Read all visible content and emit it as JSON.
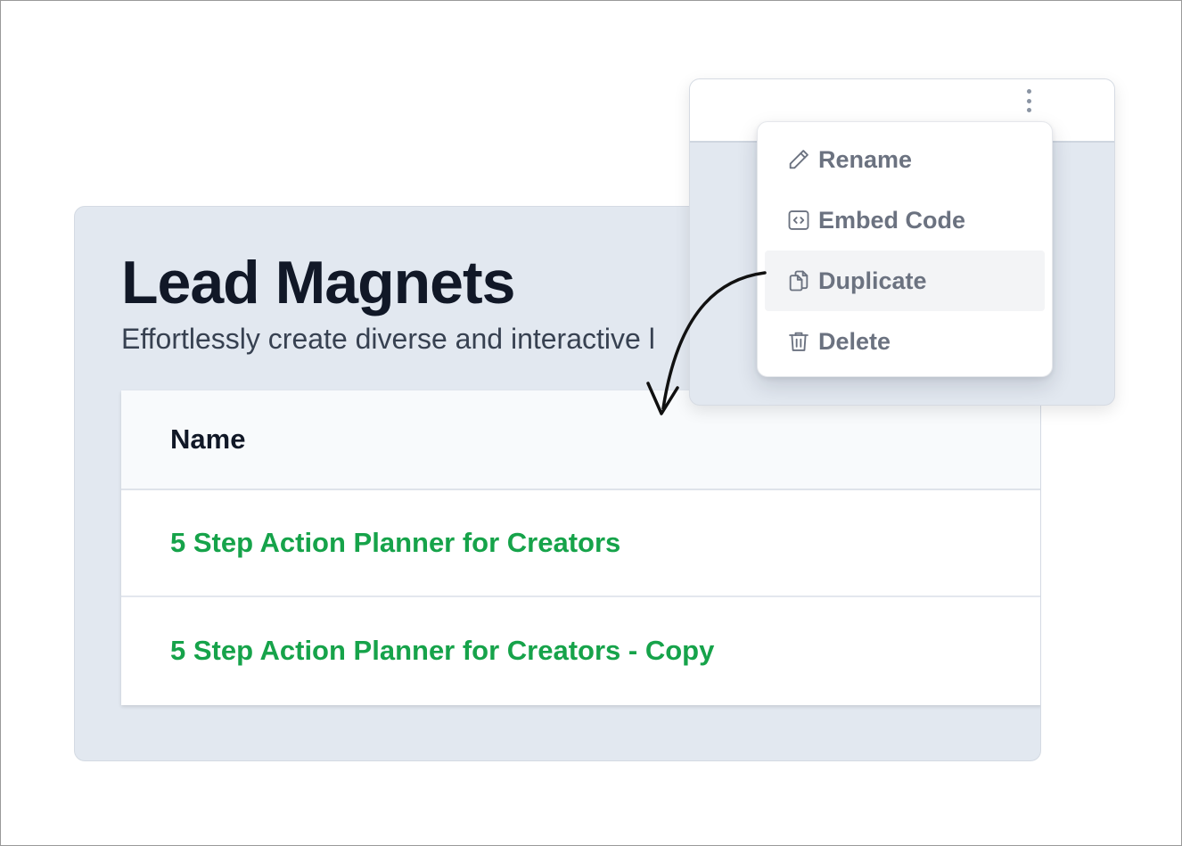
{
  "page": {
    "title": "Lead Magnets",
    "subtitle": "Effortlessly create diverse and interactive l"
  },
  "table": {
    "header_name": "Name",
    "rows": [
      {
        "name": "5 Step Action Planner for Creators"
      },
      {
        "name": "5 Step Action Planner for Creators - Copy"
      }
    ]
  },
  "menu": {
    "items": [
      {
        "label": "Rename",
        "icon": "pencil-icon"
      },
      {
        "label": "Embed Code",
        "icon": "code-icon"
      },
      {
        "label": "Duplicate",
        "icon": "copy-icon",
        "highlighted": true
      },
      {
        "label": "Delete",
        "icon": "trash-icon"
      }
    ]
  },
  "colors": {
    "panel_bg": "#e2e8f0",
    "link_green": "#16a34a",
    "menu_text": "#6b7280",
    "title_text": "#111827"
  }
}
